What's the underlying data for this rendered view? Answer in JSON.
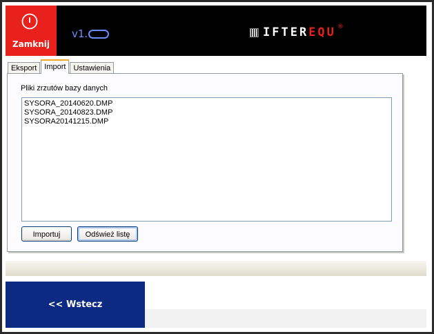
{
  "header": {
    "close_label": "Zamknij",
    "version_prefix": "v1.",
    "logo_text_white": "IFTER",
    "logo_text_red": "EQU",
    "logo_registered": "®"
  },
  "tabs": [
    {
      "label": "Eksport",
      "active": false
    },
    {
      "label": "Import",
      "active": true
    },
    {
      "label": "Ustawienia",
      "active": false
    }
  ],
  "import_panel": {
    "title": "Pliki zrzutów bazy danych",
    "files": [
      "SYSORA_20140620.DMP",
      "SYSORA_20140823.DMP",
      "SYSORA20141215.DMP"
    ],
    "import_button": "Importuj",
    "refresh_button": "Odśwież listę"
  },
  "footer": {
    "back_label": "<< Wstecz"
  },
  "colors": {
    "accent_red": "#e8211c",
    "header_bg": "#000000",
    "back_button_bg": "#0d2a82",
    "version_blue": "#6c8cff"
  }
}
